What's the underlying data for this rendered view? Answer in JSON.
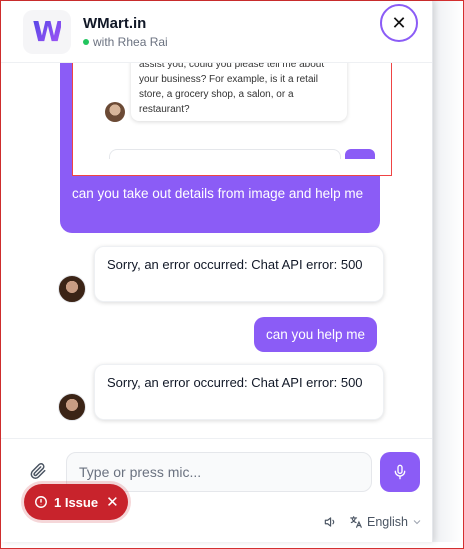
{
  "header": {
    "brand_name": "WMart.in",
    "brand_sub": "with Rhea Rai",
    "close_glyph": "✕"
  },
  "embedded_preview": {
    "bubble_text": "assist you, could you please tell me about your business? For example, is it a retail store, a grocery shop, a salon, or a restaurant?"
  },
  "messages": {
    "user_1": "can you take out details from image and help me",
    "bot_1": "Sorry, an error occurred: Chat API error: 500",
    "user_2": "can you help me",
    "bot_2": "Sorry, an error occurred: Chat API error: 500"
  },
  "composer": {
    "placeholder": "Type or press mic..."
  },
  "footer": {
    "language": "English"
  },
  "issue_badge": {
    "label": "1 Issue"
  },
  "colors": {
    "accent": "#8b5cf6",
    "issue": "#c8232c",
    "online": "#22c55e"
  },
  "icons": [
    "close-icon",
    "attach-icon",
    "mic-icon",
    "speaker-icon",
    "translate-icon",
    "chevron-down-icon",
    "alert-icon"
  ]
}
